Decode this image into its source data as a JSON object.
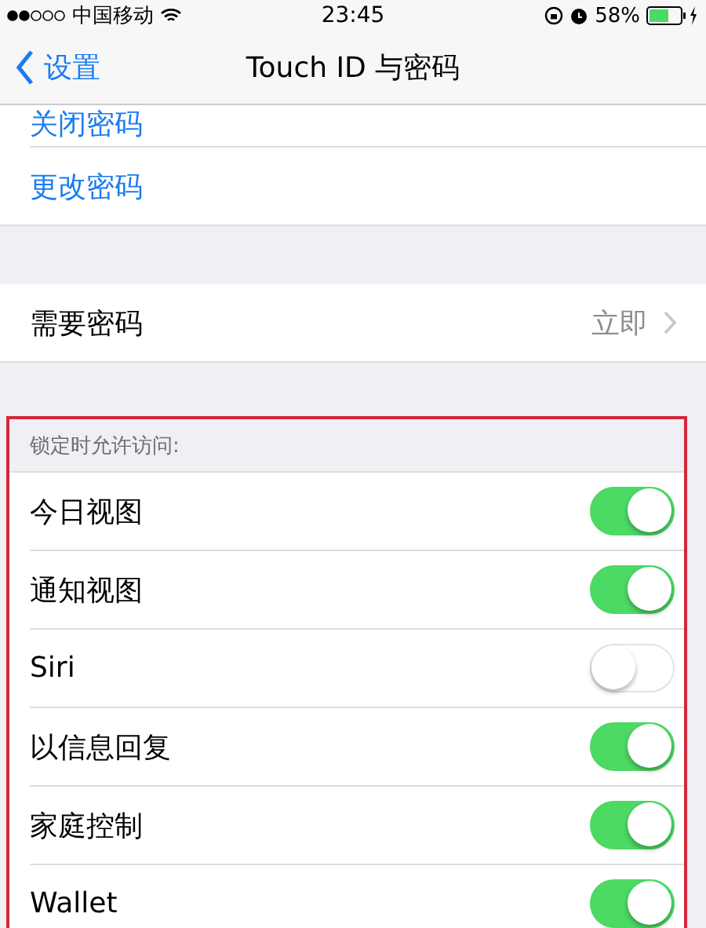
{
  "status_bar": {
    "carrier": "中国移动",
    "time": "23:45",
    "battery": "58%"
  },
  "nav": {
    "back": "设置",
    "title": "Touch ID 与密码"
  },
  "passcode_rows": [
    {
      "label": "关闭密码"
    },
    {
      "label": "更改密码"
    }
  ],
  "require_passcode": {
    "label": "需要密码",
    "value": "立即"
  },
  "lock_access": {
    "header": "锁定时允许访问:",
    "items": [
      {
        "label": "今日视图",
        "on": true
      },
      {
        "label": "通知视图",
        "on": true
      },
      {
        "label": "Siri",
        "on": false
      },
      {
        "label": "以信息回复",
        "on": true
      },
      {
        "label": "家庭控制",
        "on": true
      },
      {
        "label": "Wallet",
        "on": true
      }
    ]
  }
}
